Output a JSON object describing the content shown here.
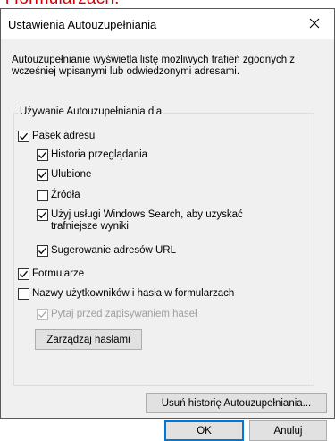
{
  "banner": {
    "text": "i formularzach."
  },
  "dialog": {
    "title": "Ustawienia Autouzupełniania",
    "description": "Autouzupełnianie wyświetla listę możliwych trafień zgodnych z wcześniej wpisanymi lub odwiedzonymi adresami.",
    "group_title": "Używanie Autouzupełniania dla",
    "options": {
      "address_bar": {
        "label": "Pasek adresu",
        "checked": true
      },
      "history": {
        "label": "Historia przeglądania",
        "checked": true
      },
      "favorites": {
        "label": "Ulubione",
        "checked": true
      },
      "feeds": {
        "label": "Źródła",
        "checked": false
      },
      "windows_search": {
        "label": "Użyj usługi Windows Search, aby uzyskać trafniejsze wyniki",
        "checked": true
      },
      "url_suggestions": {
        "label": "Sugerowanie adresów URL",
        "checked": true
      },
      "forms": {
        "label": "Formularze",
        "checked": true
      },
      "usernames_passwords": {
        "label": "Nazwy użytkowników i hasła w formularzach",
        "checked": false
      },
      "ask_before_saving": {
        "label": "Pytaj przed zapisywaniem haseł",
        "checked": true,
        "disabled": true
      }
    },
    "buttons": {
      "manage_passwords": "Zarządzaj hasłami",
      "delete_history": "Usuń historię Autouzupełniania...",
      "ok": "OK",
      "cancel": "Anuluj"
    },
    "colors": {
      "accent": "#0078d7",
      "banner_text": "#d40000",
      "client_bg": "#f0f0f0"
    },
    "icons": {
      "close": "close-icon",
      "check": "checkmark-icon"
    }
  }
}
